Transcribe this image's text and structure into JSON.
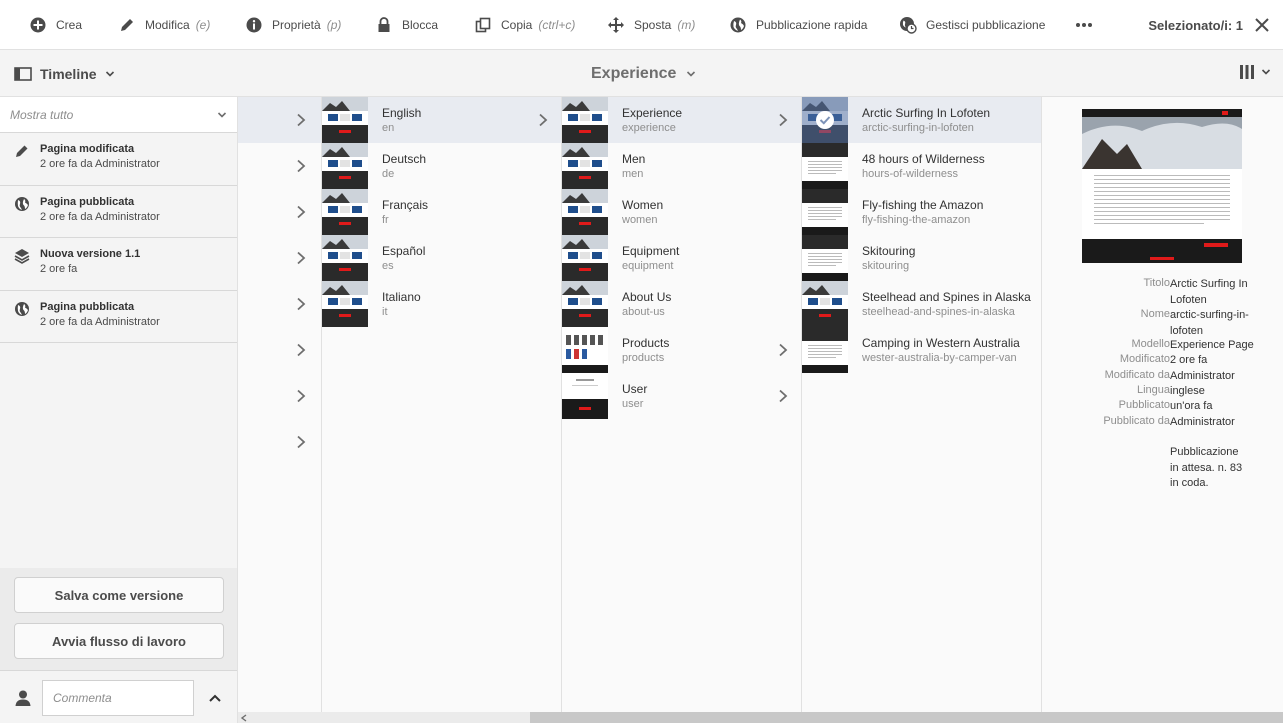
{
  "toolbar": {
    "items": [
      {
        "label": "Crea",
        "hint": "",
        "icon": "add-circle-icon"
      },
      {
        "label": "Modifica",
        "hint": "(e)",
        "icon": "pencil-icon"
      },
      {
        "label": "Proprietà",
        "hint": "(p)",
        "icon": "info-icon"
      },
      {
        "label": "Blocca",
        "hint": "",
        "icon": "lock-icon"
      },
      {
        "label": "Copia",
        "hint": "(ctrl+c)",
        "icon": "copy-icon"
      },
      {
        "label": "Sposta",
        "hint": "(m)",
        "icon": "move-icon"
      },
      {
        "label": "Pubblicazione rapida",
        "hint": "",
        "icon": "globe-icon"
      },
      {
        "label": "Gestisci pubblicazione",
        "hint": "",
        "icon": "globe-clock-icon"
      }
    ],
    "more_icon": "more-icon",
    "selected_label": "Selezionato/i: 1",
    "close_icon": "close-icon"
  },
  "subbar": {
    "rail_label": "Timeline",
    "title": "Experience"
  },
  "timeline": {
    "filter": "Mostra tutto",
    "entries": [
      {
        "title": "Pagina modificata",
        "detail": "2 ore fa da Administrator",
        "icon": "pencil-icon"
      },
      {
        "title": "Pagina pubblicata",
        "detail": "2 ore fa da Administrator",
        "icon": "globe-icon"
      },
      {
        "title": "Nuova versione 1.1",
        "detail": "2 ore fa",
        "icon": "layers-icon"
      },
      {
        "title": "Pagina pubblicata",
        "detail": "2 ore fa da Administrator",
        "icon": "globe-icon"
      }
    ],
    "save_version": "Salva come versione",
    "start_workflow": "Avvia flusso di lavoro",
    "comment_placeholder": "Commenta"
  },
  "columns": {
    "languages": [
      {
        "name": "English",
        "sub": "en",
        "active": true
      },
      {
        "name": "Deutsch",
        "sub": "de"
      },
      {
        "name": "Français",
        "sub": "fr"
      },
      {
        "name": "Español",
        "sub": "es"
      },
      {
        "name": "Italiano",
        "sub": "it"
      }
    ],
    "sections": [
      {
        "name": "Experience",
        "sub": "experience",
        "active": true,
        "chevron": true
      },
      {
        "name": "Men",
        "sub": "men"
      },
      {
        "name": "Women",
        "sub": "women"
      },
      {
        "name": "Equipment",
        "sub": "equipment"
      },
      {
        "name": "About Us",
        "sub": "about-us"
      },
      {
        "name": "Products",
        "sub": "products",
        "chevron": true
      },
      {
        "name": "User",
        "sub": "user",
        "chevron": true
      }
    ],
    "pages": [
      {
        "name": "Arctic Surfing In Lofoten",
        "sub": "arctic-surfing-in-lofoten",
        "active": true,
        "selected": true
      },
      {
        "name": "48 hours of Wilderness",
        "sub": "hours-of-wilderness"
      },
      {
        "name": "Fly-fishing the Amazon",
        "sub": "fly-fishing-the-amazon"
      },
      {
        "name": "Skitouring",
        "sub": "skitouring"
      },
      {
        "name": "Steelhead and Spines in Alaska",
        "sub": "steelhead-and-spines-in-alaska"
      },
      {
        "name": "Camping in Western Australia",
        "sub": "wester-australia-by-camper-van"
      }
    ]
  },
  "details": {
    "rows": [
      {
        "key": "Titolo",
        "value": "Arctic Surfing In Lofoten"
      },
      {
        "key": "Nome",
        "value": "arctic-surfing-in-lofoten"
      },
      {
        "key": "Modello",
        "value": "Experience Page"
      },
      {
        "key": "Modificato",
        "value": "2 ore fa"
      },
      {
        "key": "Modificato da",
        "value": "Administrator"
      },
      {
        "key": "Lingua",
        "value": "inglese"
      },
      {
        "key": "Pubblicato",
        "value": "un'ora fa"
      },
      {
        "key": "Pubblicato da",
        "value": "Administrator"
      }
    ],
    "status": "Pubblicazione in attesa. n. 83 in coda."
  }
}
